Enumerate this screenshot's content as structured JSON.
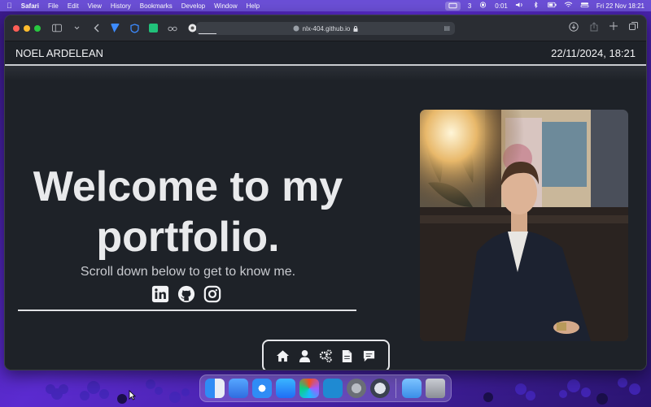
{
  "menubar": {
    "app_name": "Safari",
    "items": [
      "File",
      "Edit",
      "View",
      "History",
      "Bookmarks",
      "Develop",
      "Window",
      "Help"
    ],
    "notification_count": "3",
    "timer": "0:01",
    "datetime": "Fri 22 Nov  18:21"
  },
  "browser": {
    "url": "nlx-404.github.io"
  },
  "site": {
    "owner_name": "NOEL ARDELEAN",
    "date_time": "22/11/2024, 18:21",
    "hero_title_line1": "Welcome to my",
    "hero_title_line2": "portfolio.",
    "hero_subtitle": "Scroll down below to get to know me.",
    "socials": [
      "linkedin-icon",
      "github-icon",
      "instagram-icon"
    ],
    "nav_icons": [
      "home-icon",
      "user-icon",
      "gears-icon",
      "document-icon",
      "chat-icon"
    ]
  },
  "dock": {
    "apps": [
      "finder",
      "testflight",
      "safari",
      "app-store",
      "figma",
      "vscode",
      "system-settings",
      "quicktime",
      "downloads-folder",
      "trash"
    ]
  },
  "colors": {
    "page_bg": "#1e2228",
    "text": "#e9eaec",
    "menubar": "#6b4fd6"
  }
}
